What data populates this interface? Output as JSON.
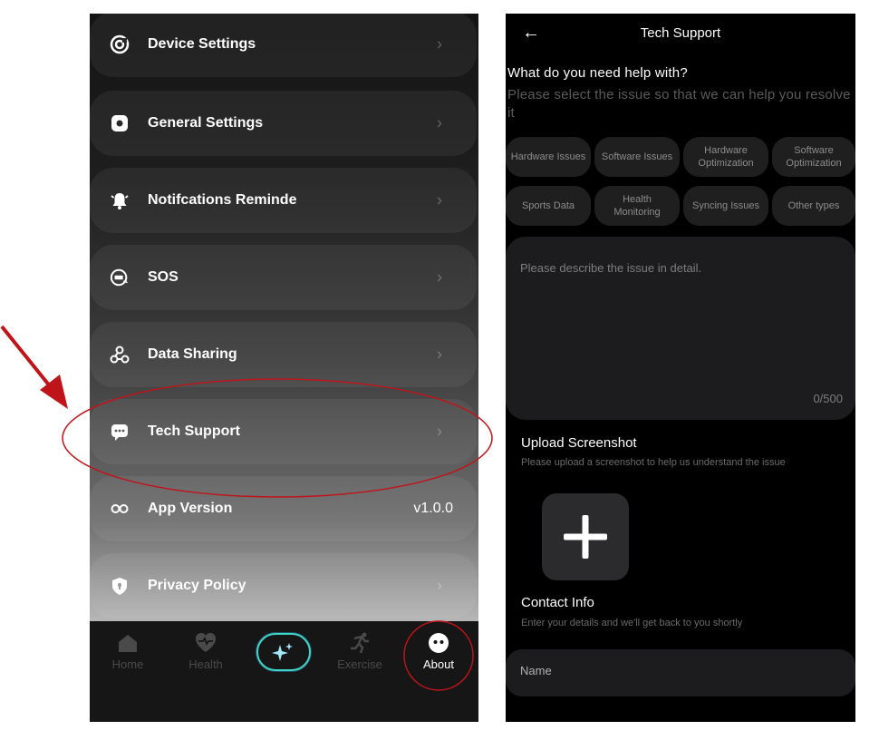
{
  "left_panel": {
    "menu_items": [
      {
        "label": "Device Settings",
        "icon": "device-settings-icon",
        "trailing": "›"
      },
      {
        "label": "General Settings",
        "icon": "gear-icon",
        "trailing": "›"
      },
      {
        "label": "Notifcations Reminde",
        "icon": "bell-icon",
        "trailing": "›"
      },
      {
        "label": "SOS",
        "icon": "sos-icon",
        "trailing": "›"
      },
      {
        "label": "Data Sharing",
        "icon": "share-icon",
        "trailing": "›"
      },
      {
        "label": "Tech Support",
        "icon": "chat-icon",
        "trailing": "›"
      },
      {
        "label": "App Version",
        "icon": "infinity-icon",
        "value": "v1.0.0"
      },
      {
        "label": "Privacy Policy",
        "icon": "shield-icon",
        "trailing": "›"
      }
    ],
    "bottom_nav": {
      "items": [
        {
          "label": "Home",
          "icon": "home-icon",
          "active": false
        },
        {
          "label": "Health",
          "icon": "heart-pulse-icon",
          "active": false
        },
        {
          "label": "",
          "icon": "sparkle-icon",
          "active": false
        },
        {
          "label": "Exercise",
          "icon": "runner-icon",
          "active": false
        },
        {
          "label": "About",
          "icon": "smiley-icon",
          "active": true
        }
      ]
    }
  },
  "right_panel": {
    "title": "Tech Support",
    "help_heading": "What do you need help with?",
    "help_subtext": "Please select the issue so that we can help you resolve it",
    "issue_types": [
      "Hardware Issues",
      "Software Issues",
      "Hardware Optimization",
      "Software Optimization",
      "Sports Data",
      "Health Monitoring",
      "Syncing Issues",
      "Other types"
    ],
    "description": {
      "placeholder": "Please describe the issue in detail.",
      "counter": "0/500"
    },
    "upload": {
      "heading": "Upload Screenshot",
      "subtext": "Please upload a screenshot to help us understand the issue"
    },
    "contact": {
      "heading": "Contact Info",
      "subtext": "Enter your details and we'll get back to you shortly",
      "name_label": "Name"
    }
  },
  "colors": {
    "annotation_red": "#c0141b",
    "ai_button_border": "#3fd5c5",
    "chip_bg": "#1f1f1f",
    "field_bg": "#1c1c1e"
  }
}
